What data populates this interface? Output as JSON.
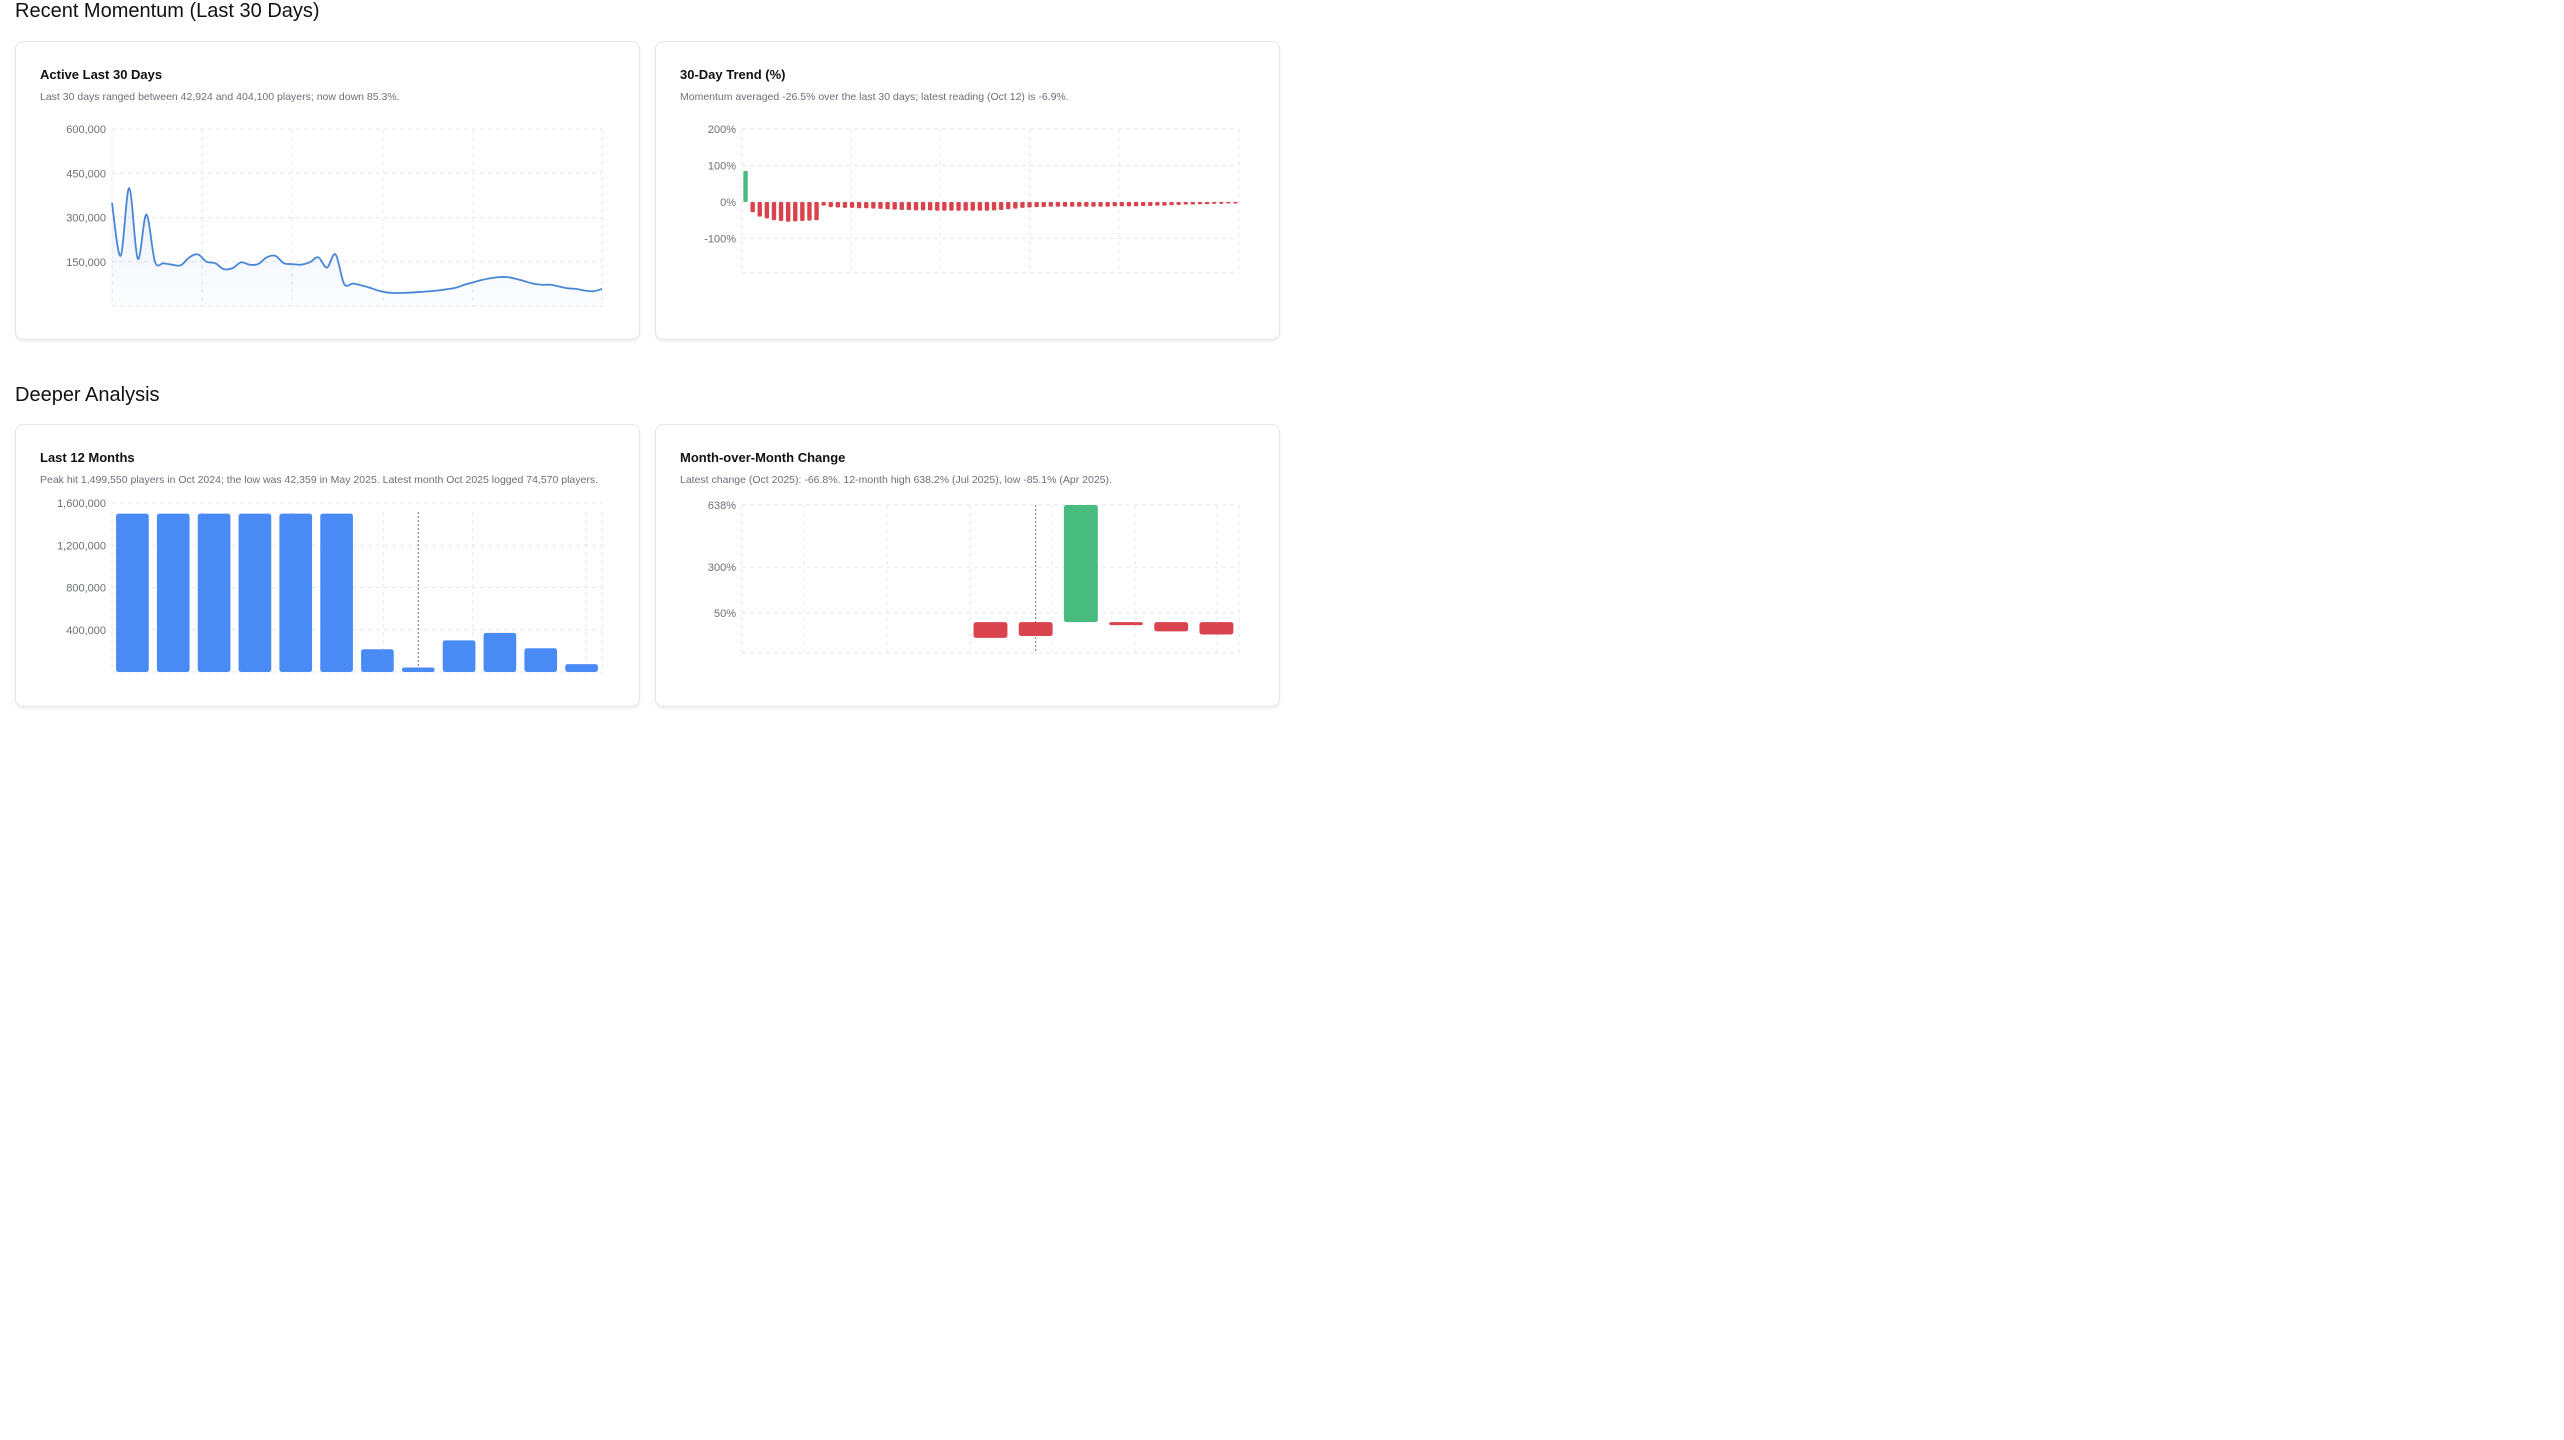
{
  "sections": {
    "recent_title": "Recent Momentum (Last 30 Days)",
    "deeper_title": "Deeper Analysis"
  },
  "cards": {
    "active30": {
      "title": "Active Last 30 Days",
      "subtitle": "Last 30 days ranged between 42,924 and 404,100 players; now down 85.3%."
    },
    "trend30": {
      "title": "30-Day Trend (%)",
      "subtitle": "Momentum averaged -26.5% over the last 30 days; latest reading (Oct 12) is -6.9%."
    },
    "last12": {
      "title": "Last 12 Months",
      "subtitle": "Peak hit 1,499,550 players in Oct 2024; the low was 42,359 in May 2025. Latest month Oct 2025 logged 74,570 players."
    },
    "mom": {
      "title": "Month-over-Month Change",
      "subtitle": "Latest change (Oct 2025): -66.8%. 12-month high 638.2% (Jul 2025), low -85.1% (Apr 2025)."
    }
  },
  "colors": {
    "line": "#4a86d6",
    "bar_blue": "#4a8af4",
    "positive": "#48bb7e",
    "negative": "#d9434e",
    "grid": "#e4e6ea"
  },
  "chart_data": [
    {
      "id": "active30",
      "type": "area",
      "ylim": [
        0,
        600000
      ],
      "yticks": [
        150000,
        300000,
        450000,
        600000
      ],
      "ytick_labels": [
        "150,000",
        "300,000",
        "450,000",
        "600,000"
      ],
      "values": [
        350000,
        170000,
        400000,
        160000,
        310000,
        150000,
        145000,
        140000,
        138000,
        165000,
        175000,
        150000,
        145000,
        125000,
        128000,
        148000,
        140000,
        142000,
        165000,
        170000,
        145000,
        142000,
        140000,
        148000,
        165000,
        130000,
        175000,
        75000,
        76000,
        70000,
        62000,
        52000,
        46000,
        44000,
        44500,
        46000,
        48000,
        50000,
        53000,
        57000,
        62000,
        72000,
        80000,
        88000,
        94000,
        98000,
        98000,
        92000,
        84000,
        76000,
        72000,
        72000,
        66000,
        60000,
        58000,
        52000,
        50000,
        58000
      ]
    },
    {
      "id": "trend30",
      "type": "bar",
      "ylim": [
        -200,
        200
      ],
      "yticks": [
        -100,
        0,
        100,
        200
      ],
      "ytick_labels": [
        "-100%",
        "0%",
        "100%",
        "200%"
      ],
      "values": [
        85,
        -28,
        -40,
        -45,
        -50,
        -52,
        -54,
        -53,
        -52,
        -51,
        -50,
        -10,
        -14,
        -15,
        -16,
        -16,
        -17,
        -17,
        -18,
        -19,
        -20,
        -21,
        -22,
        -22,
        -23,
        -23,
        -23,
        -24,
        -24,
        -24,
        -24,
        -24,
        -24,
        -24,
        -24,
        -23,
        -22,
        -20,
        -18,
        -16,
        -15,
        -14,
        -14,
        -13,
        -13,
        -13,
        -13,
        -13,
        -13,
        -13,
        -13,
        -13,
        -12,
        -12,
        -12,
        -12,
        -11,
        -11,
        -10,
        -10,
        -9,
        -8,
        -7,
        -7,
        -6,
        -6,
        -5,
        -5,
        -4,
        -4
      ]
    },
    {
      "id": "last12",
      "type": "bar",
      "ylim": [
        0,
        1600000
      ],
      "yticks": [
        400000,
        800000,
        1200000,
        1600000
      ],
      "ytick_labels": [
        "400,000",
        "800,000",
        "1,200,000",
        "1,600,000"
      ],
      "values": [
        1499550,
        1499550,
        1499550,
        1499550,
        1499550,
        1499550,
        215000,
        42359,
        300000,
        370000,
        225000,
        74570
      ]
    },
    {
      "id": "mom",
      "type": "bar",
      "ylim": [
        -250,
        638
      ],
      "yticks": [
        50,
        300,
        638
      ],
      "ytick_labels": [
        "50%",
        "300%",
        "638%"
      ],
      "values": [
        null,
        null,
        null,
        null,
        null,
        -85.1,
        -75.0,
        638.2,
        -15.0,
        -50.0,
        -66.8
      ]
    }
  ]
}
